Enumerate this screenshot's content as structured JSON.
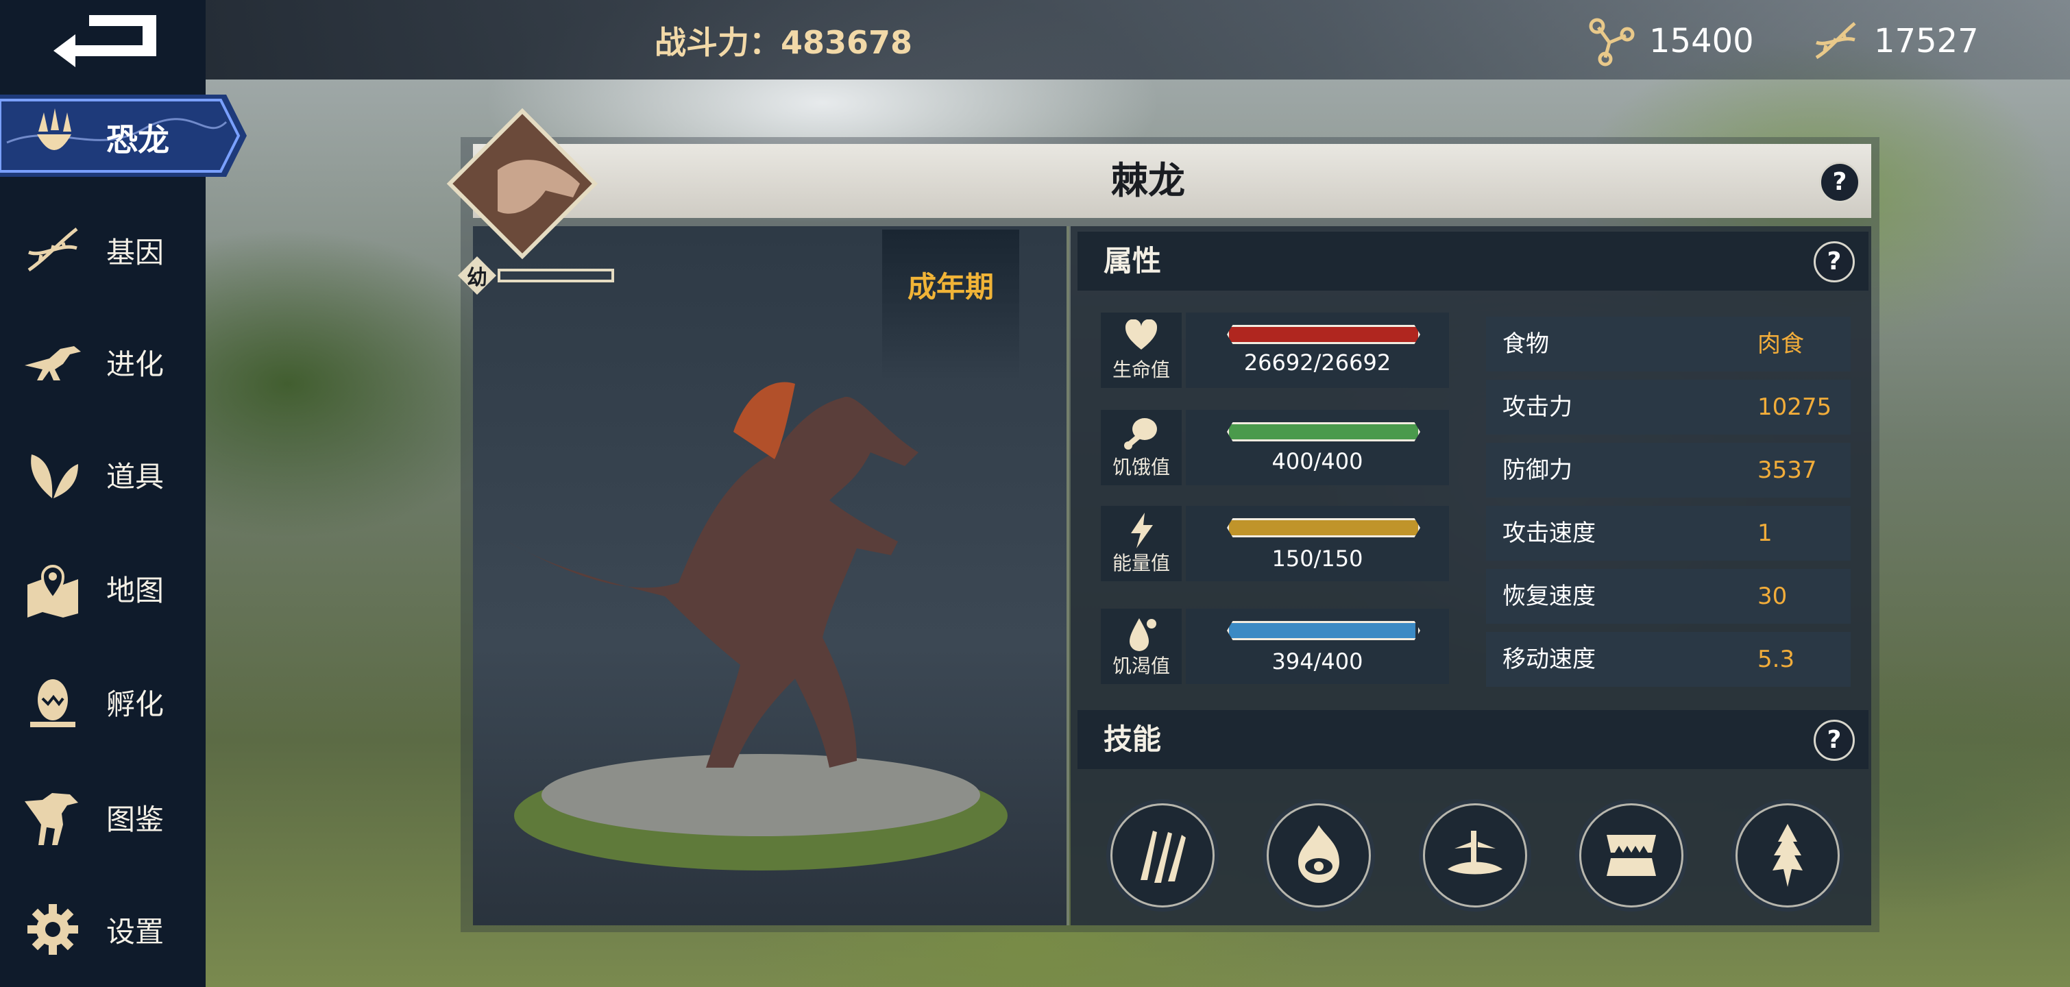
{
  "top_bar": {
    "combat_power_label": "战斗力：",
    "combat_power_value": "483678",
    "currency": [
      {
        "icon": "molecule-icon",
        "value": "15400"
      },
      {
        "icon": "dna-icon",
        "value": "17527"
      }
    ]
  },
  "sidebar": {
    "items": [
      {
        "label": "恐龙",
        "icon": "dino-claw-icon",
        "active": true
      },
      {
        "label": "基因",
        "icon": "dna-icon"
      },
      {
        "label": "进化",
        "icon": "raptor-icon"
      },
      {
        "label": "道具",
        "icon": "leaf-icon"
      },
      {
        "label": "地图",
        "icon": "map-pin-icon"
      },
      {
        "label": "孵化",
        "icon": "egg-icon"
      },
      {
        "label": "图鉴",
        "icon": "trex-icon"
      },
      {
        "label": "设置",
        "icon": "gear-icon"
      }
    ]
  },
  "dino": {
    "name": "棘龙",
    "growth_badge": "幼",
    "stage": "成年期"
  },
  "attributes": {
    "title": "属性",
    "vitals": [
      {
        "name": "生命值",
        "icon": "heart-icon",
        "value": "26692/26692",
        "fraction": 1.0,
        "color": "#b0261f"
      },
      {
        "name": "饥饿值",
        "icon": "meat-icon",
        "value": "400/400",
        "fraction": 1.0,
        "color": "#4a9a4c"
      },
      {
        "name": "能量值",
        "icon": "lightning-icon",
        "value": "150/150",
        "fraction": 1.0,
        "color": "#c0942a"
      },
      {
        "name": "饥渴值",
        "icon": "water-drop-icon",
        "value": "394/400",
        "fraction": 0.985,
        "color": "#3b8ac4"
      }
    ],
    "stats": [
      {
        "name": "食物",
        "value": "肉食"
      },
      {
        "name": "攻击力",
        "value": "10275"
      },
      {
        "name": "防御力",
        "value": "3537"
      },
      {
        "name": "攻击速度",
        "value": "1"
      },
      {
        "name": "恢复速度",
        "value": "30"
      },
      {
        "name": "移动速度",
        "value": "5.3"
      }
    ]
  },
  "skills": {
    "title": "技能",
    "items": [
      {
        "icon": "claw-slash-icon"
      },
      {
        "icon": "fire-eye-icon"
      },
      {
        "icon": "splash-icon"
      },
      {
        "icon": "bite-icon"
      },
      {
        "icon": "spike-burst-icon"
      }
    ]
  },
  "help_label": "?"
}
